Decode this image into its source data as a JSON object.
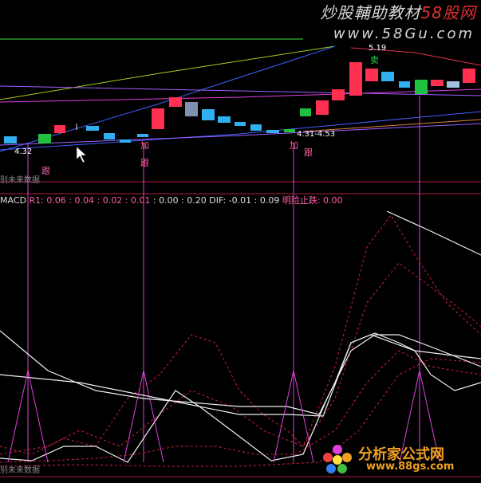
{
  "watermark": {
    "title_cn": "炒股輔助教材",
    "title_red": "58股网",
    "url": "www.58Gu.com"
  },
  "price_labels": {
    "high": "5.19",
    "low_left": "4.32",
    "range": "4.31-4.53"
  },
  "signals": {
    "sell": "卖",
    "add": "加",
    "follow": "跟",
    "add2": "加",
    "follow2": "跟",
    "follow3": "跟"
  },
  "panel_labels": {
    "future_top": "别未来数据",
    "future_bottom": "别未来数据"
  },
  "macd": {
    "name": "MACD",
    "params": "R1: 0.06 : 0.04 : 0.02 : 0.01",
    "values": ": 0.00 : 0.20",
    "dif": "DIF: -0.01 : 0.09",
    "alert": "明险止跌: 0.00"
  },
  "logo": {
    "name": "分析家公式网",
    "url": "www.88gs.com"
  },
  "colors": {
    "up": "#ff3050",
    "down": "#30b0f0",
    "green": "#20c040",
    "magenta": "#e040e0"
  }
}
